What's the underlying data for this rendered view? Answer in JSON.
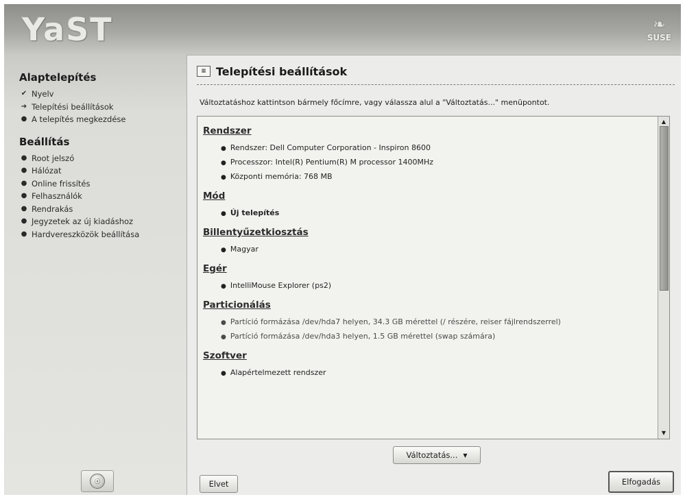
{
  "header": {
    "logo_text": "YaST",
    "brand_text": "SUSE"
  },
  "sidebar": {
    "sections": [
      {
        "title": "Alaptelepítés",
        "items": [
          {
            "label": "Nyelv",
            "state": "done"
          },
          {
            "label": "Telepítési beállítások",
            "state": "current"
          },
          {
            "label": "A telepítés megkezdése",
            "state": "todo"
          }
        ]
      },
      {
        "title": "Beállítás",
        "items": [
          {
            "label": "Root jelszó",
            "state": "todo"
          },
          {
            "label": "Hálózat",
            "state": "todo"
          },
          {
            "label": "Online frissítés",
            "state": "todo"
          },
          {
            "label": "Felhasználók",
            "state": "todo"
          },
          {
            "label": "Rendrakás",
            "state": "todo"
          },
          {
            "label": "Jegyzetek az új kiadáshoz",
            "state": "todo"
          },
          {
            "label": "Hardvereszközök beállítása",
            "state": "todo"
          }
        ]
      }
    ]
  },
  "panel": {
    "title": "Telepítési beállítások",
    "description": "Változtatáshoz kattintson bármely főcímre, vagy válassza alul a \"Változtatás...\" menüpontot.",
    "sections": [
      {
        "heading": "Rendszer",
        "items": [
          {
            "text": "Rendszer: Dell Computer Corporation - Inspiron 8600",
            "style": "normal"
          },
          {
            "text": "Processzor: Intel(R) Pentium(R) M processor 1400MHz",
            "style": "normal"
          },
          {
            "text": "Központi memória: 768 MB",
            "style": "normal"
          }
        ]
      },
      {
        "heading": "Mód",
        "items": [
          {
            "text": "Új telepítés",
            "style": "bold"
          }
        ]
      },
      {
        "heading": "Billentyűzetkiosztás",
        "items": [
          {
            "text": "Magyar",
            "style": "normal"
          }
        ]
      },
      {
        "heading": "Egér",
        "items": [
          {
            "text": "IntelliMouse Explorer (ps2)",
            "style": "normal"
          }
        ]
      },
      {
        "heading": "Particionálás",
        "items": [
          {
            "text": "Partíció formázása /dev/hda7 helyen, 34.3 GB mérettel (/ részére, reiser fájlrendszerrel)",
            "style": "dim"
          },
          {
            "text": "Partíció formázása /dev/hda3 helyen, 1.5 GB mérettel (swap számára)",
            "style": "dim"
          }
        ]
      },
      {
        "heading": "Szoftver",
        "items": [
          {
            "text": "Alapértelmezett rendszer",
            "style": "normal"
          }
        ]
      }
    ]
  },
  "buttons": {
    "change": "Változtatás...",
    "back": "Elvet",
    "accept": "Elfogadás"
  },
  "icons": {
    "done": "check-icon",
    "current": "arrow-right-icon",
    "todo": "bullet-icon"
  }
}
